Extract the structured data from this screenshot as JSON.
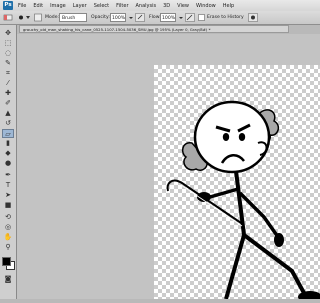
{
  "app": {
    "logo": "Ps"
  },
  "menu": [
    "File",
    "Edit",
    "Image",
    "Layer",
    "Select",
    "Filter",
    "Analysis",
    "3D",
    "View",
    "Window",
    "Help"
  ],
  "options": {
    "mode_label": "Mode:",
    "mode_value": "Brush",
    "opacity_label": "Opacity:",
    "opacity_value": "100%",
    "flow_label": "Flow:",
    "flow_value": "100%",
    "erase_to_history": "Erase to History"
  },
  "document": {
    "tab_title": "grouchy_old_man_shaking_his_cane_0525-1107-1504-5036_SMU.jpg @ 195% (Layer 0, Gray/8#) *"
  },
  "colors": {
    "accent": "#1f6fa9",
    "workspace": "#c3c3c3",
    "toolbox": "#cfcfcf"
  }
}
